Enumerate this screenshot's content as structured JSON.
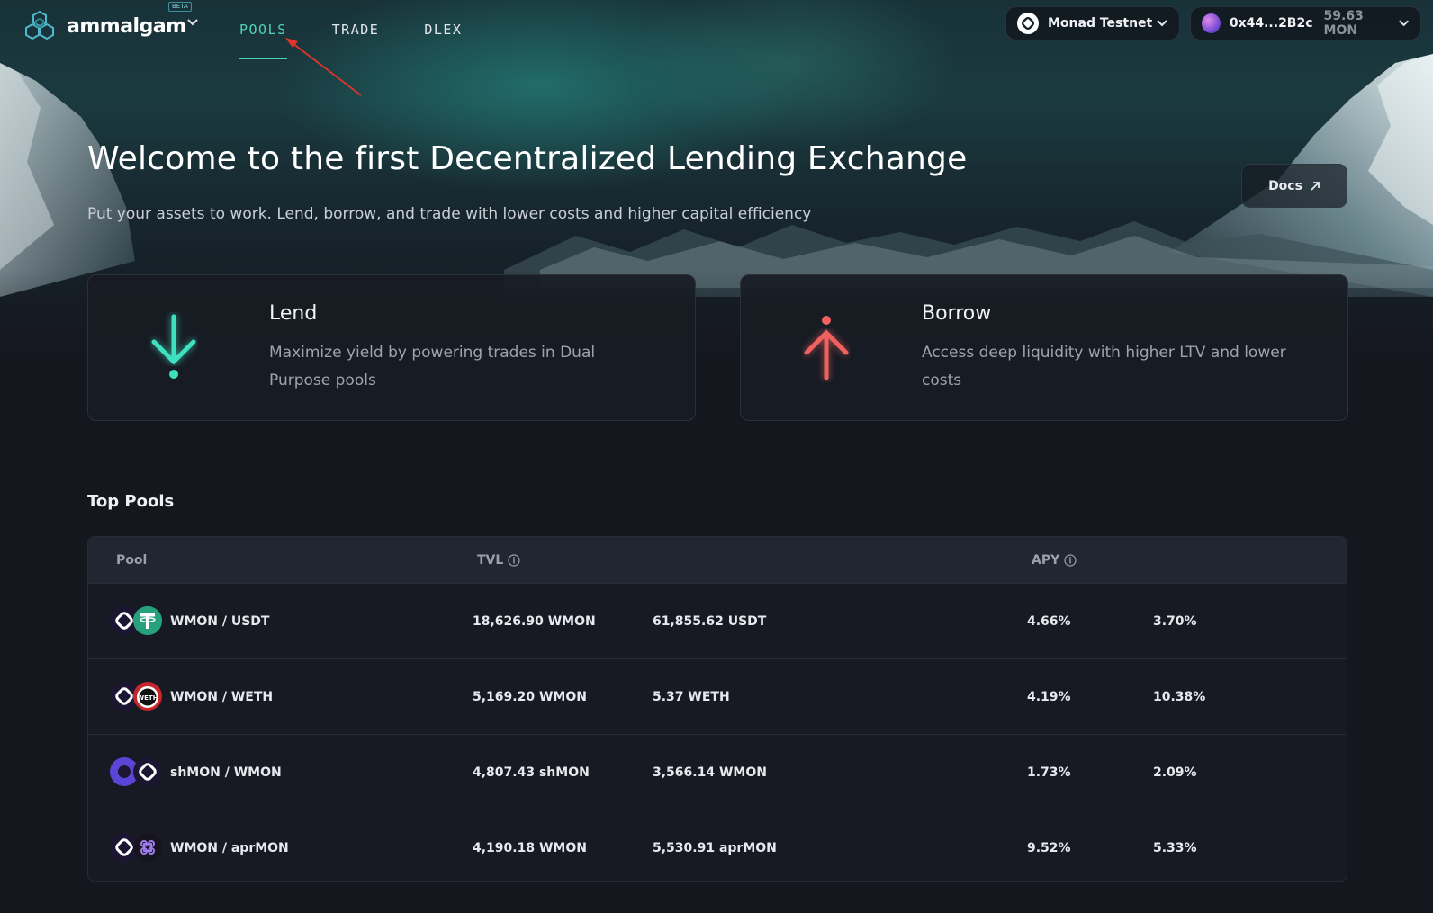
{
  "brand": {
    "name": "ammalgam",
    "badge": "BETA"
  },
  "nav": [
    {
      "label": "POOLS",
      "active": true
    },
    {
      "label": "TRADE",
      "active": false
    },
    {
      "label": "DLEX",
      "active": false
    }
  ],
  "network": {
    "label": "Monad Testnet"
  },
  "wallet": {
    "address": "0x44...2B2c",
    "balance": "59.63 MON"
  },
  "hero": {
    "title": "Welcome to the first Decentralized Lending Exchange",
    "subtitle": "Put your assets to work. Lend, borrow, and trade with lower costs and higher capital efficiency",
    "docs_label": "Docs"
  },
  "cards": {
    "lend": {
      "title": "Lend",
      "description": "Maximize yield by powering trades in Dual Purpose pools",
      "icon": "arrow-down-icon",
      "color": "#3fe0c0"
    },
    "borrow": {
      "title": "Borrow",
      "description": "Access deep liquidity with higher LTV and lower costs",
      "icon": "arrow-up-icon",
      "color": "#f0625f"
    }
  },
  "top_pools": {
    "title": "Top Pools",
    "headers": {
      "pool": "Pool",
      "tvl": "TVL",
      "apy": "APY"
    },
    "rows": [
      {
        "pair": "WMON / USDT",
        "tvl_a": "18,626.90 WMON",
        "tvl_b": "61,855.62 USDT",
        "apy_a": "4.66%",
        "apy_b": "3.70%",
        "icons": [
          "wmon-icon",
          "usdt-icon"
        ]
      },
      {
        "pair": "WMON / WETH",
        "tvl_a": "5,169.20 WMON",
        "tvl_b": "5.37 WETH",
        "apy_a": "4.19%",
        "apy_b": "10.38%",
        "icons": [
          "wmon-icon",
          "weth-icon"
        ]
      },
      {
        "pair": "shMON / WMON",
        "tvl_a": "4,807.43 shMON",
        "tvl_b": "3,566.14 WMON",
        "apy_a": "1.73%",
        "apy_b": "2.09%",
        "icons": [
          "shmon-icon",
          "wmon-icon"
        ]
      },
      {
        "pair": "WMON / aprMON",
        "tvl_a": "4,190.18 WMON",
        "tvl_b": "5,530.91 aprMON",
        "apy_a": "9.52%",
        "apy_b": "5.33%",
        "icons": [
          "wmon-icon",
          "aprmon-icon"
        ]
      }
    ]
  },
  "weth_icon_text": "WETH"
}
